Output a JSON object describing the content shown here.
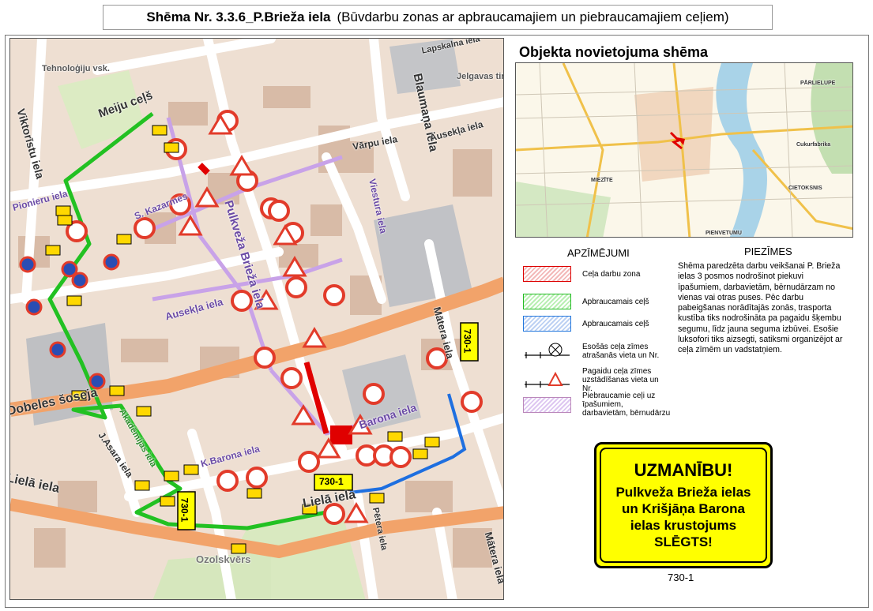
{
  "title": {
    "bold": "Shēma Nr. 3.3.6_P.Brieža iela",
    "rest": "(Būvdarbu zonas ar apbraucamajiem un  piebraucamajiem ceļiem)"
  },
  "map": {
    "streets": [
      "Meiju ceļš",
      "Viktorīstu iela",
      "Pionieru iela",
      "S. Kazarmes",
      "Pulkveža Brieža iela",
      "Blaumaņa iela",
      "Lapskalna iela",
      "Vārpu iela",
      "Viestura iela",
      "Ausekļa iela",
      "Ausekļa iela",
      "Dobeles šoseja",
      "Barona iela",
      "K.Barona iela",
      "J.Asara iela",
      "Lielā iela",
      "Lielā iela",
      "Pētera iela",
      "Mātera iela",
      "Mātera iela",
      "Ozolskvērs",
      "Jelgavas tirgus",
      "Tehnoloģiju vsk.",
      "Akadēmijas iela"
    ],
    "sign_tags": [
      "730-1",
      "730-1",
      "730-1"
    ]
  },
  "overview": {
    "title": "Objekta novietojuma shēma",
    "labels": [
      "PĀRLIELUPE",
      "MIEZĪTE",
      "CIETOKSNIS",
      "PIENVETUMU",
      "Cukurfabrika"
    ]
  },
  "legend": {
    "title": "APZĪMĒJUMI",
    "items": [
      {
        "label": "Ceļa darbu zona",
        "style": "red"
      },
      {
        "label": "Apbraucamais ceļš",
        "style": "green"
      },
      {
        "label": "Apbraucamais ceļš",
        "style": "blue"
      },
      {
        "label": "Esošās ceļa zīmes atrašanās vieta un Nr.",
        "style": "existing-sign"
      },
      {
        "label": "Pagaidu ceļa zīmes uzstādīšanas vieta un Nr.",
        "style": "temporary-sign"
      },
      {
        "label": "Piebraucamie ceļi uz īpašumiem, darbavietām, bērnudārzu",
        "style": "purple"
      }
    ]
  },
  "notes": {
    "title": "PIEZĪMES",
    "text": "Shēma paredzēta darbu veikšanai P. Brieža ielas  3 posmos nodrošinot piekuvi īpašumiem, darbavietām, bērnudārzam no vienas vai otras puses. Pēc darbu pabeigšanas norādītajās zonās, trasporta kustība tiks nodrošināta pa pagaidu šķembu segumu, līdz jauna seguma izbūvei. Esošie luksofori tiks aizsegti, satiksmi organizējot ar ceļa zīmēm un vadstatņiem."
  },
  "warning": {
    "heading": "UZMANĪBU!",
    "lines": [
      "Pulkveža Brieža ielas",
      "un Krišjāņa Barona",
      "ielas krustojums",
      "SLĒGTS!"
    ],
    "sign_number": "730-1"
  },
  "colors": {
    "work_zone": "#e00000",
    "detour_green": "#22c122",
    "detour_blue": "#1e6fe0",
    "access_purple": "#c8a2e8",
    "warning_yellow": "#ffff00",
    "main_road": "#f2a36a"
  }
}
